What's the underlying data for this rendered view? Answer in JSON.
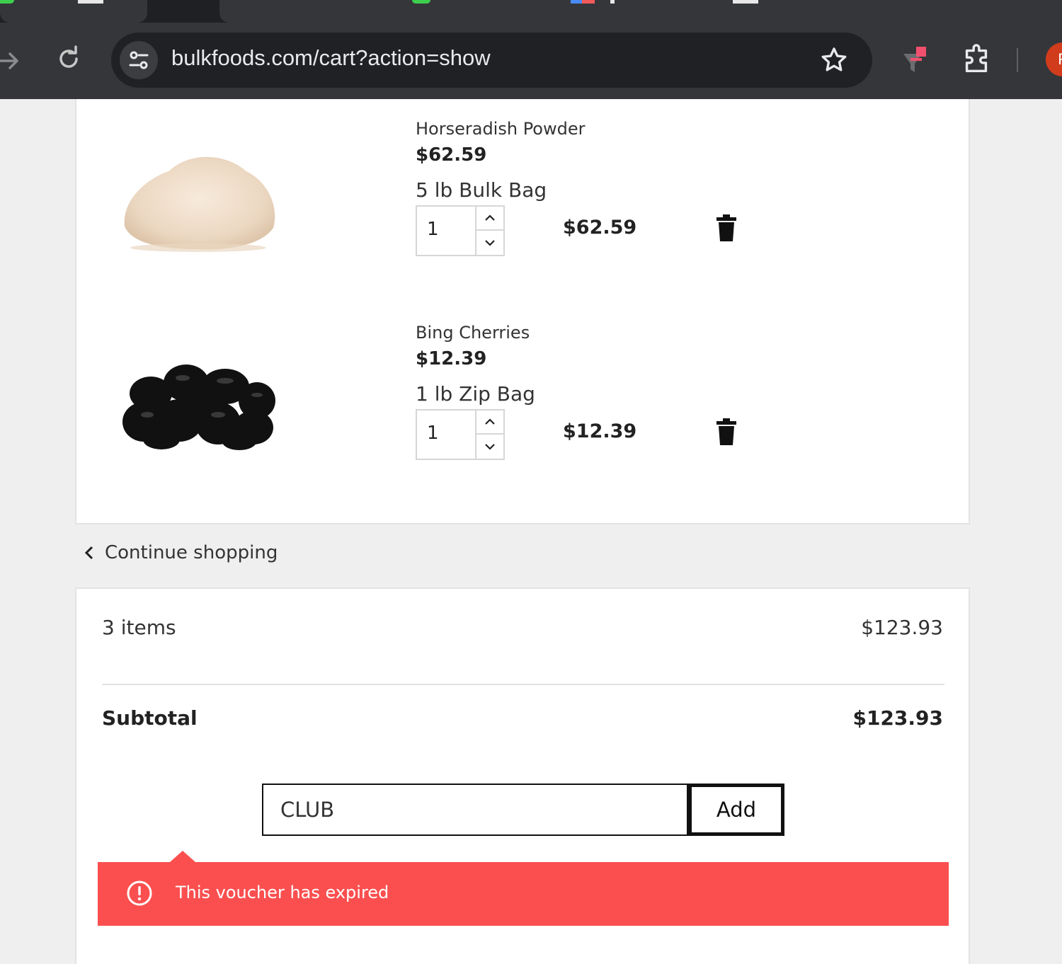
{
  "browser": {
    "url": "bulkfoods.com/cart?action=show",
    "profile_initial": "F"
  },
  "cart": {
    "items": [
      {
        "name": "Horseradish Powder",
        "unit_price": "$62.59",
        "variant": "5 lb Bulk Bag",
        "quantity": "1",
        "line_total": "$62.59"
      },
      {
        "name": "Bing Cherries",
        "unit_price": "$12.39",
        "variant": "1 lb Zip Bag",
        "quantity": "1",
        "line_total": "$12.39"
      }
    ]
  },
  "continue_shopping": "Continue shopping",
  "summary": {
    "items_label": "3 items",
    "items_value": "$123.93",
    "subtotal_label": "Subtotal",
    "subtotal_value": "$123.93"
  },
  "voucher": {
    "value": "CLUB",
    "add_label": "Add",
    "error": "This voucher has expired"
  },
  "colors": {
    "alert": "#fb4f4f",
    "chrome": "#35363a"
  }
}
